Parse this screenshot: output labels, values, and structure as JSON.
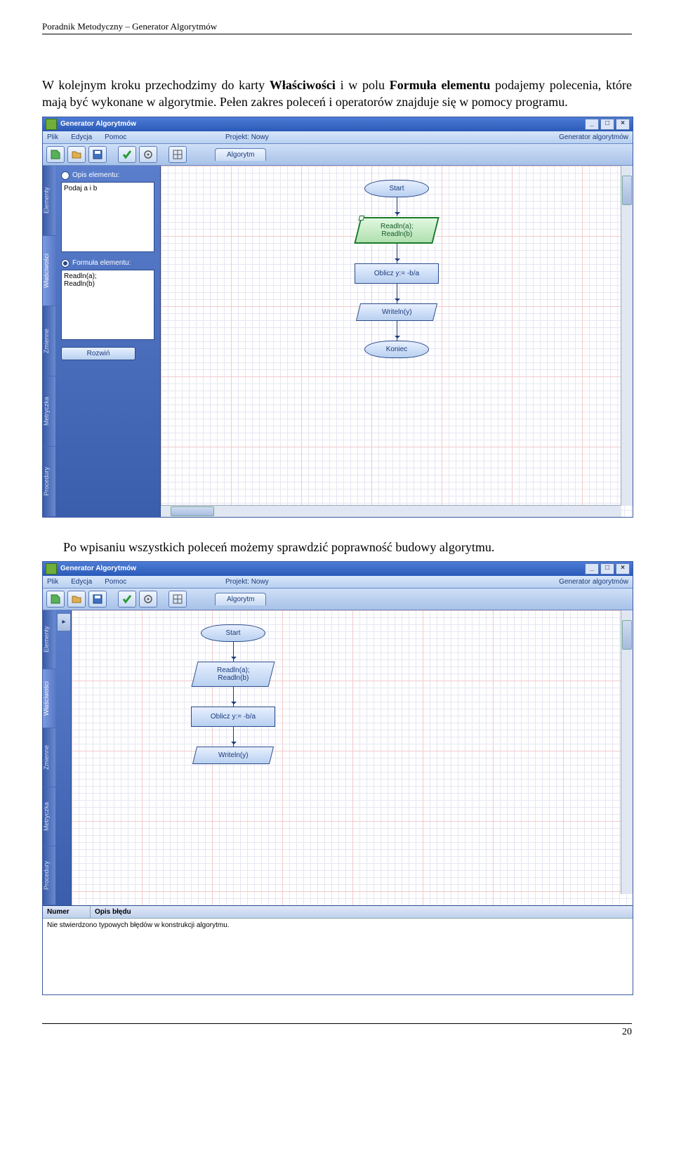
{
  "doc": {
    "header": "Poradnik Metodyczny – Generator Algorytmów",
    "para1_pre": "W kolejnym kroku przechodzimy do karty ",
    "para1_b1": "Właściwości",
    "para1_mid": " i w polu ",
    "para1_b2": "Formuła elementu",
    "para1_post": " podajemy polecenia, które mają być wykonane w algorytmie. Pełen zakres poleceń i operatorów znajduje się w pomocy programu.",
    "para2": "Po wpisaniu wszystkich poleceń możemy sprawdzić poprawność budowy algorytmu.",
    "page_number": "20"
  },
  "app": {
    "title": "Generator Algorytmów",
    "menu": {
      "plik": "Plik",
      "edycja": "Edycja",
      "pomoc": "Pomoc"
    },
    "project_label": "Projekt:",
    "project_name": "Nowy",
    "brand": "Generator algorytmów",
    "tab": "Algorytm",
    "vtabs": {
      "elementy": "Elementy",
      "wlasciwosci": "Właściwości",
      "zmienne": "Zmienne",
      "metryczka": "Metryczka",
      "procedury": "Procedury"
    },
    "side": {
      "opis_label": "Opis elementu:",
      "opis_value": "Podaj a i b",
      "formula_label": "Formuła elementu:",
      "formula_value": "Readln(a);\nReadln(b)",
      "rozwin": "Rozwiń"
    },
    "flow": {
      "start": "Start",
      "read": "Readln(a);\nReadln(b)",
      "calc": "Oblicz y:= -b/a",
      "write": "Writeln(y)",
      "end": "Koniec"
    },
    "errors": {
      "col_numer": "Numer",
      "col_opis": "Opis błędu",
      "msg": "Nie stwierdzono typowych błędów w konstrukcji algorytmu."
    }
  }
}
